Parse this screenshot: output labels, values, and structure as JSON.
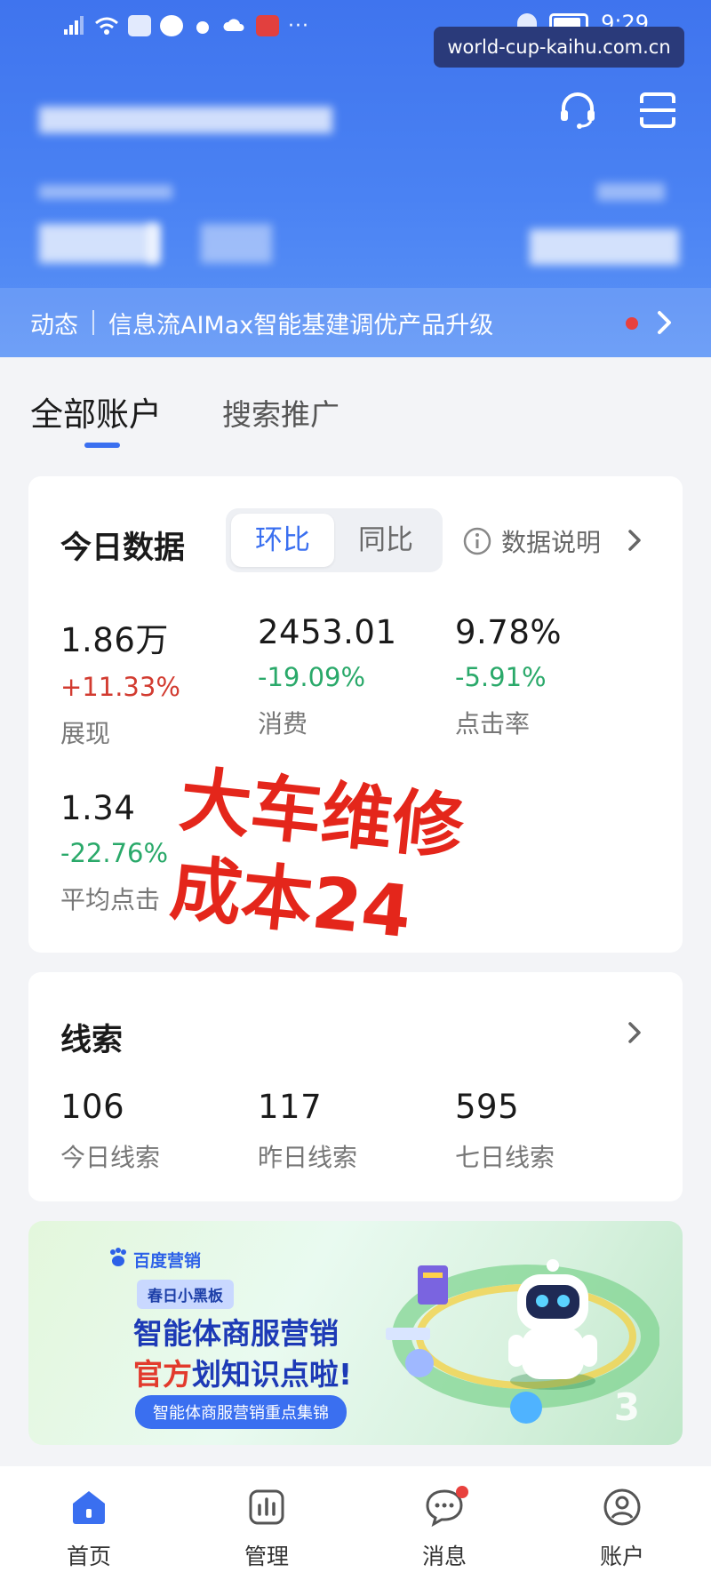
{
  "status_bar": {
    "time": "9:29",
    "icons": [
      "signal-icon",
      "wifi-icon",
      "app-icon",
      "app-icon",
      "weather-icon",
      "cloud-icon",
      "book-icon",
      "more-icon",
      "mute-icon",
      "battery-icon"
    ],
    "more": "···"
  },
  "watermark": "world-cup-kaihu.com.cn",
  "header": {
    "icons": [
      "headset-icon",
      "scan-icon"
    ]
  },
  "news": {
    "label": "动态",
    "text": "信息流AIMax智能基建调优产品升级"
  },
  "tabs": {
    "active": "全部账户",
    "inactive": "搜索推广"
  },
  "today": {
    "title": "今日数据",
    "toggle": [
      "环比",
      "同比"
    ],
    "note": "数据说明",
    "metrics": [
      {
        "value": "1.86万",
        "change": "+11.33%",
        "label": "展现",
        "dir": "up"
      },
      {
        "value": "2453.01",
        "change": "-19.09%",
        "label": "消费",
        "dir": "down"
      },
      {
        "value": "9.78%",
        "change": "-5.91%",
        "label": "点击率",
        "dir": "down"
      },
      {
        "value": "1.34",
        "change": "-22.76%",
        "label": "平均点击",
        "dir": "down"
      }
    ]
  },
  "overlay": {
    "line1": "大车维修",
    "line2": "成本24"
  },
  "leads": {
    "title": "线索",
    "items": [
      {
        "value": "106",
        "label": "今日线索"
      },
      {
        "value": "117",
        "label": "昨日线索"
      },
      {
        "value": "595",
        "label": "七日线索"
      }
    ]
  },
  "banner": {
    "logo": "百度营销",
    "pill": "春日小黑板",
    "line1": "智能体商服营销",
    "line2_red": "官方",
    "line2_rest": "划知识点啦!",
    "cta": "智能体商服营销重点集锦",
    "page": "3"
  },
  "colors": {
    "header": "#4a82f3",
    "accent": "#3a6ff0",
    "up": "#d23b30",
    "down": "#2aa96a",
    "overlay": "#e4261b"
  },
  "bottom_nav": [
    {
      "label": "首页",
      "icon": "home-icon"
    },
    {
      "label": "管理",
      "icon": "chart-icon"
    },
    {
      "label": "消息",
      "icon": "message-icon"
    },
    {
      "label": "账户",
      "icon": "user-icon"
    }
  ]
}
